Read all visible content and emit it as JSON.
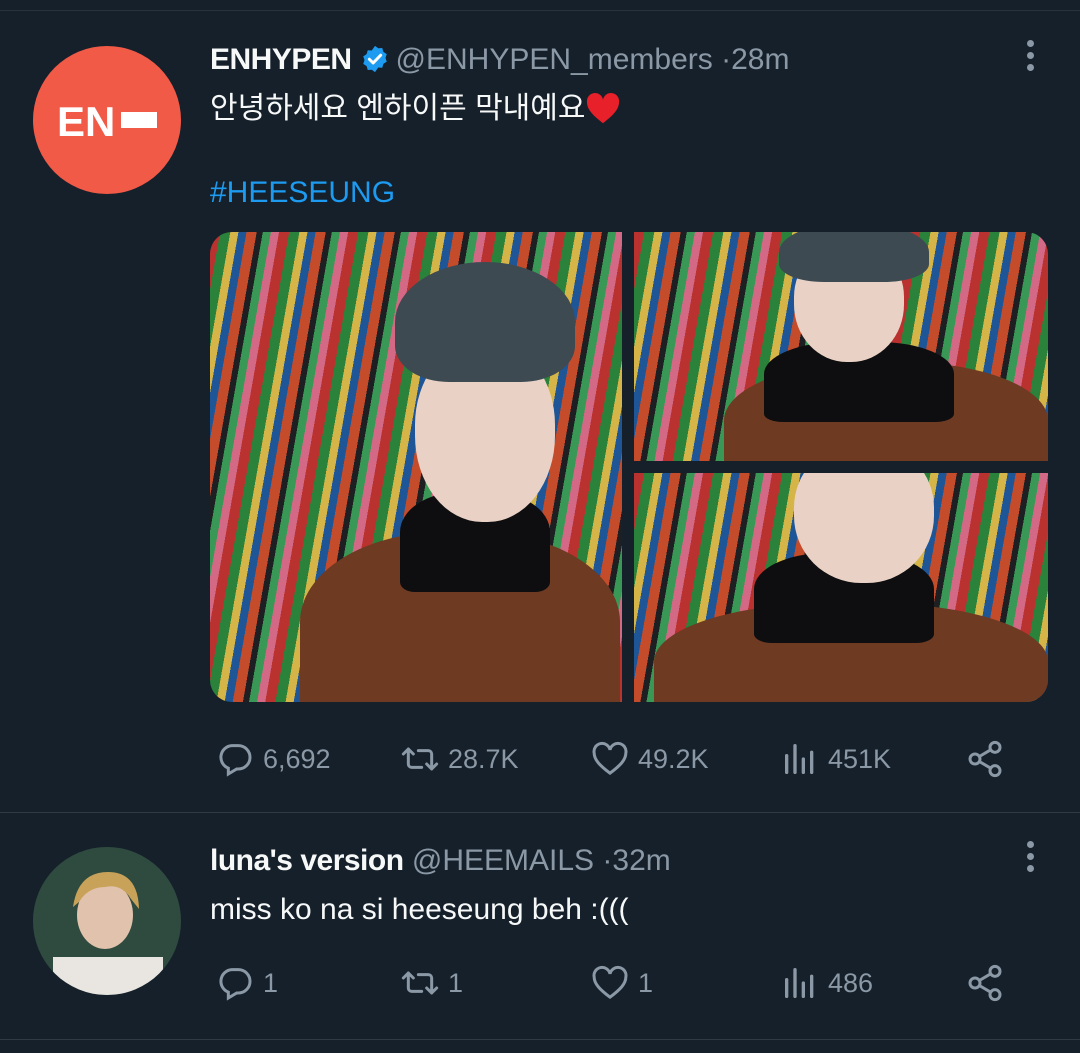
{
  "tweets": [
    {
      "name": "ENHYPEN",
      "verified": true,
      "handle": "@ENHYPEN_members",
      "dot": "·",
      "time": "28m",
      "text": "안녕하세요 엔하이픈 막내예요",
      "hashtag": "#HEESEUNG",
      "avatar_text": "EN",
      "avatar_color": "#f05a47",
      "stats": {
        "replies": "6,692",
        "retweets": "28.7K",
        "likes": "49.2K",
        "views": "451K"
      }
    },
    {
      "name": "luna's version",
      "handle": "@HEEMAILS",
      "dot": "·",
      "time": "32m",
      "text": "miss ko na si heeseung beh :(((",
      "stats": {
        "replies": "1",
        "retweets": "1",
        "likes": "1",
        "views": "486"
      }
    }
  ],
  "colors": {
    "background": "#15202b",
    "accent": "#1d9bf0",
    "muted": "#8b98a5",
    "heart": "#f91880"
  },
  "icons": [
    "verified-badge-icon",
    "heart-emoji-icon",
    "more-icon",
    "reply-icon",
    "retweet-icon",
    "like-icon",
    "views-icon",
    "share-icon"
  ]
}
